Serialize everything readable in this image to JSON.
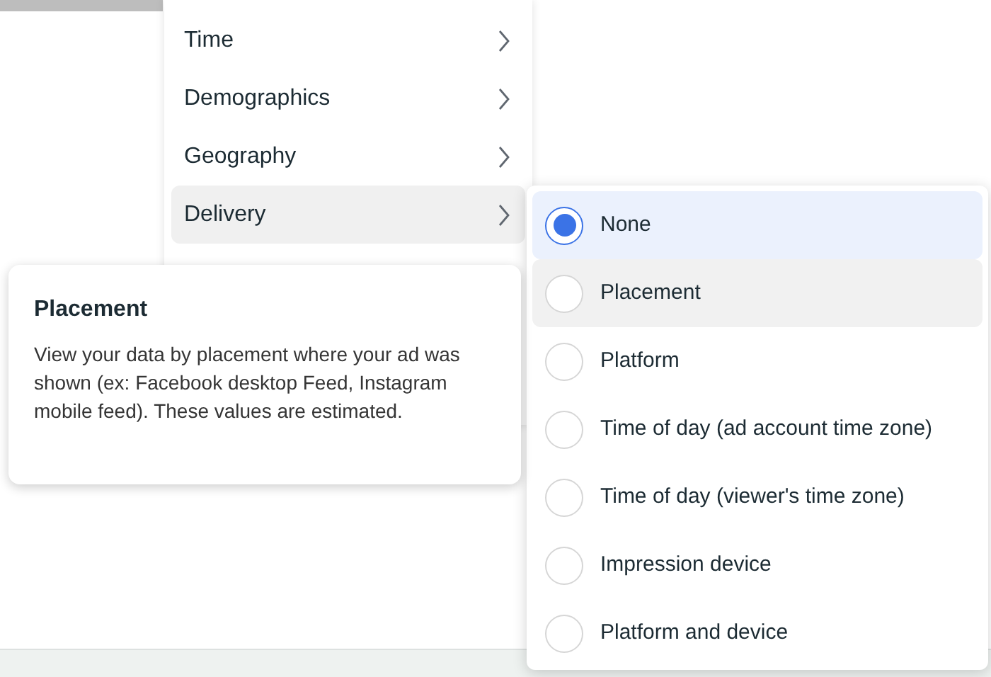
{
  "menu": {
    "items": [
      {
        "label": "Time",
        "selected": false
      },
      {
        "label": "Demographics",
        "selected": false
      },
      {
        "label": "Geography",
        "selected": false
      },
      {
        "label": "Delivery",
        "selected": true
      }
    ]
  },
  "submenu": {
    "options": [
      {
        "label": "None",
        "selected": true,
        "hovered": false
      },
      {
        "label": "Placement",
        "selected": false,
        "hovered": true
      },
      {
        "label": "Platform",
        "selected": false,
        "hovered": false
      },
      {
        "label": "Time of day (ad account time zone)",
        "selected": false,
        "hovered": false
      },
      {
        "label": "Time of day (viewer's time zone)",
        "selected": false,
        "hovered": false
      },
      {
        "label": "Impression device",
        "selected": false,
        "hovered": false
      },
      {
        "label": "Platform and device",
        "selected": false,
        "hovered": false
      }
    ]
  },
  "tooltip": {
    "title": "Placement",
    "body": "View your data by placement where your ad was shown (ex: Facebook desktop Feed, Instagram mobile feed). These values are estimated."
  }
}
